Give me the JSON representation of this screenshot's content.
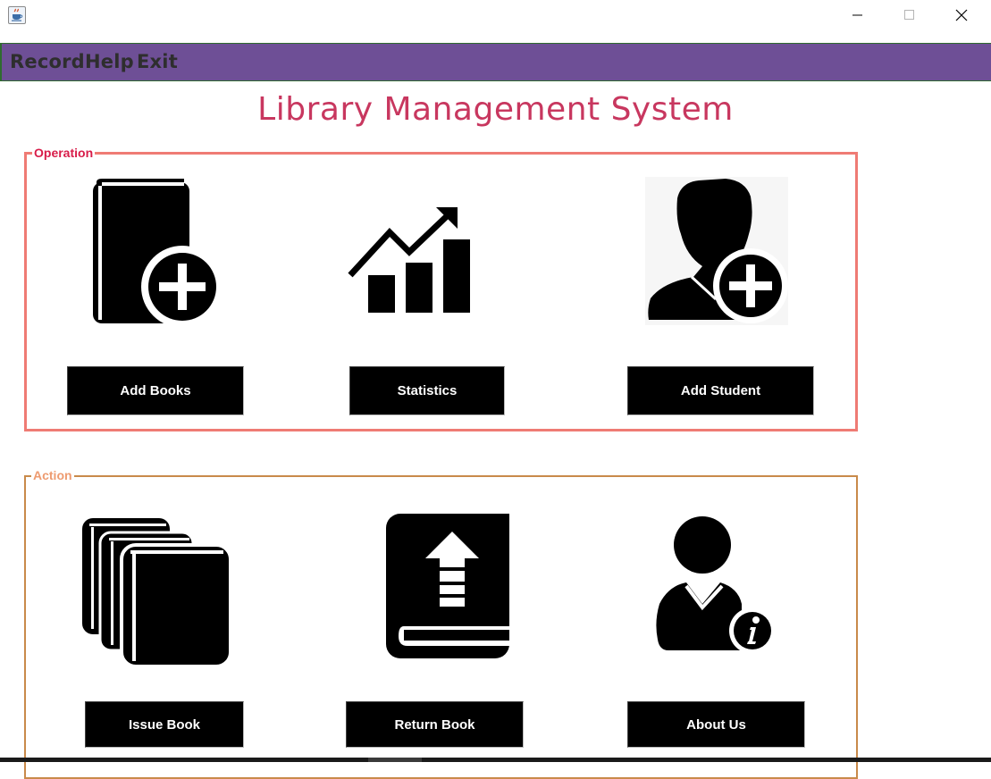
{
  "window": {
    "minimize_symbol": "—",
    "maximize_symbol": "☐",
    "close_symbol": "✕"
  },
  "menu": {
    "items": [
      "Record",
      "Help",
      "Exit"
    ]
  },
  "title": "Library Management System",
  "operation": {
    "legend": "Operation",
    "buttons": [
      "Add Books",
      "Statistics",
      "Add Student"
    ]
  },
  "action": {
    "legend": "Action",
    "buttons": [
      "Issue Book",
      "Return Book",
      "About Us"
    ]
  },
  "colors": {
    "menubar": "#6e4f96",
    "title": "#c8375f",
    "operation_border": "#ef7b74",
    "operation_label": "#d81c49",
    "action_border": "#c98a4a",
    "action_label": "#ee9b70"
  },
  "icons": [
    "java-app-icon",
    "add-book-icon",
    "statistics-icon",
    "add-student-icon",
    "issue-book-icon",
    "return-book-icon",
    "about-us-icon"
  ]
}
